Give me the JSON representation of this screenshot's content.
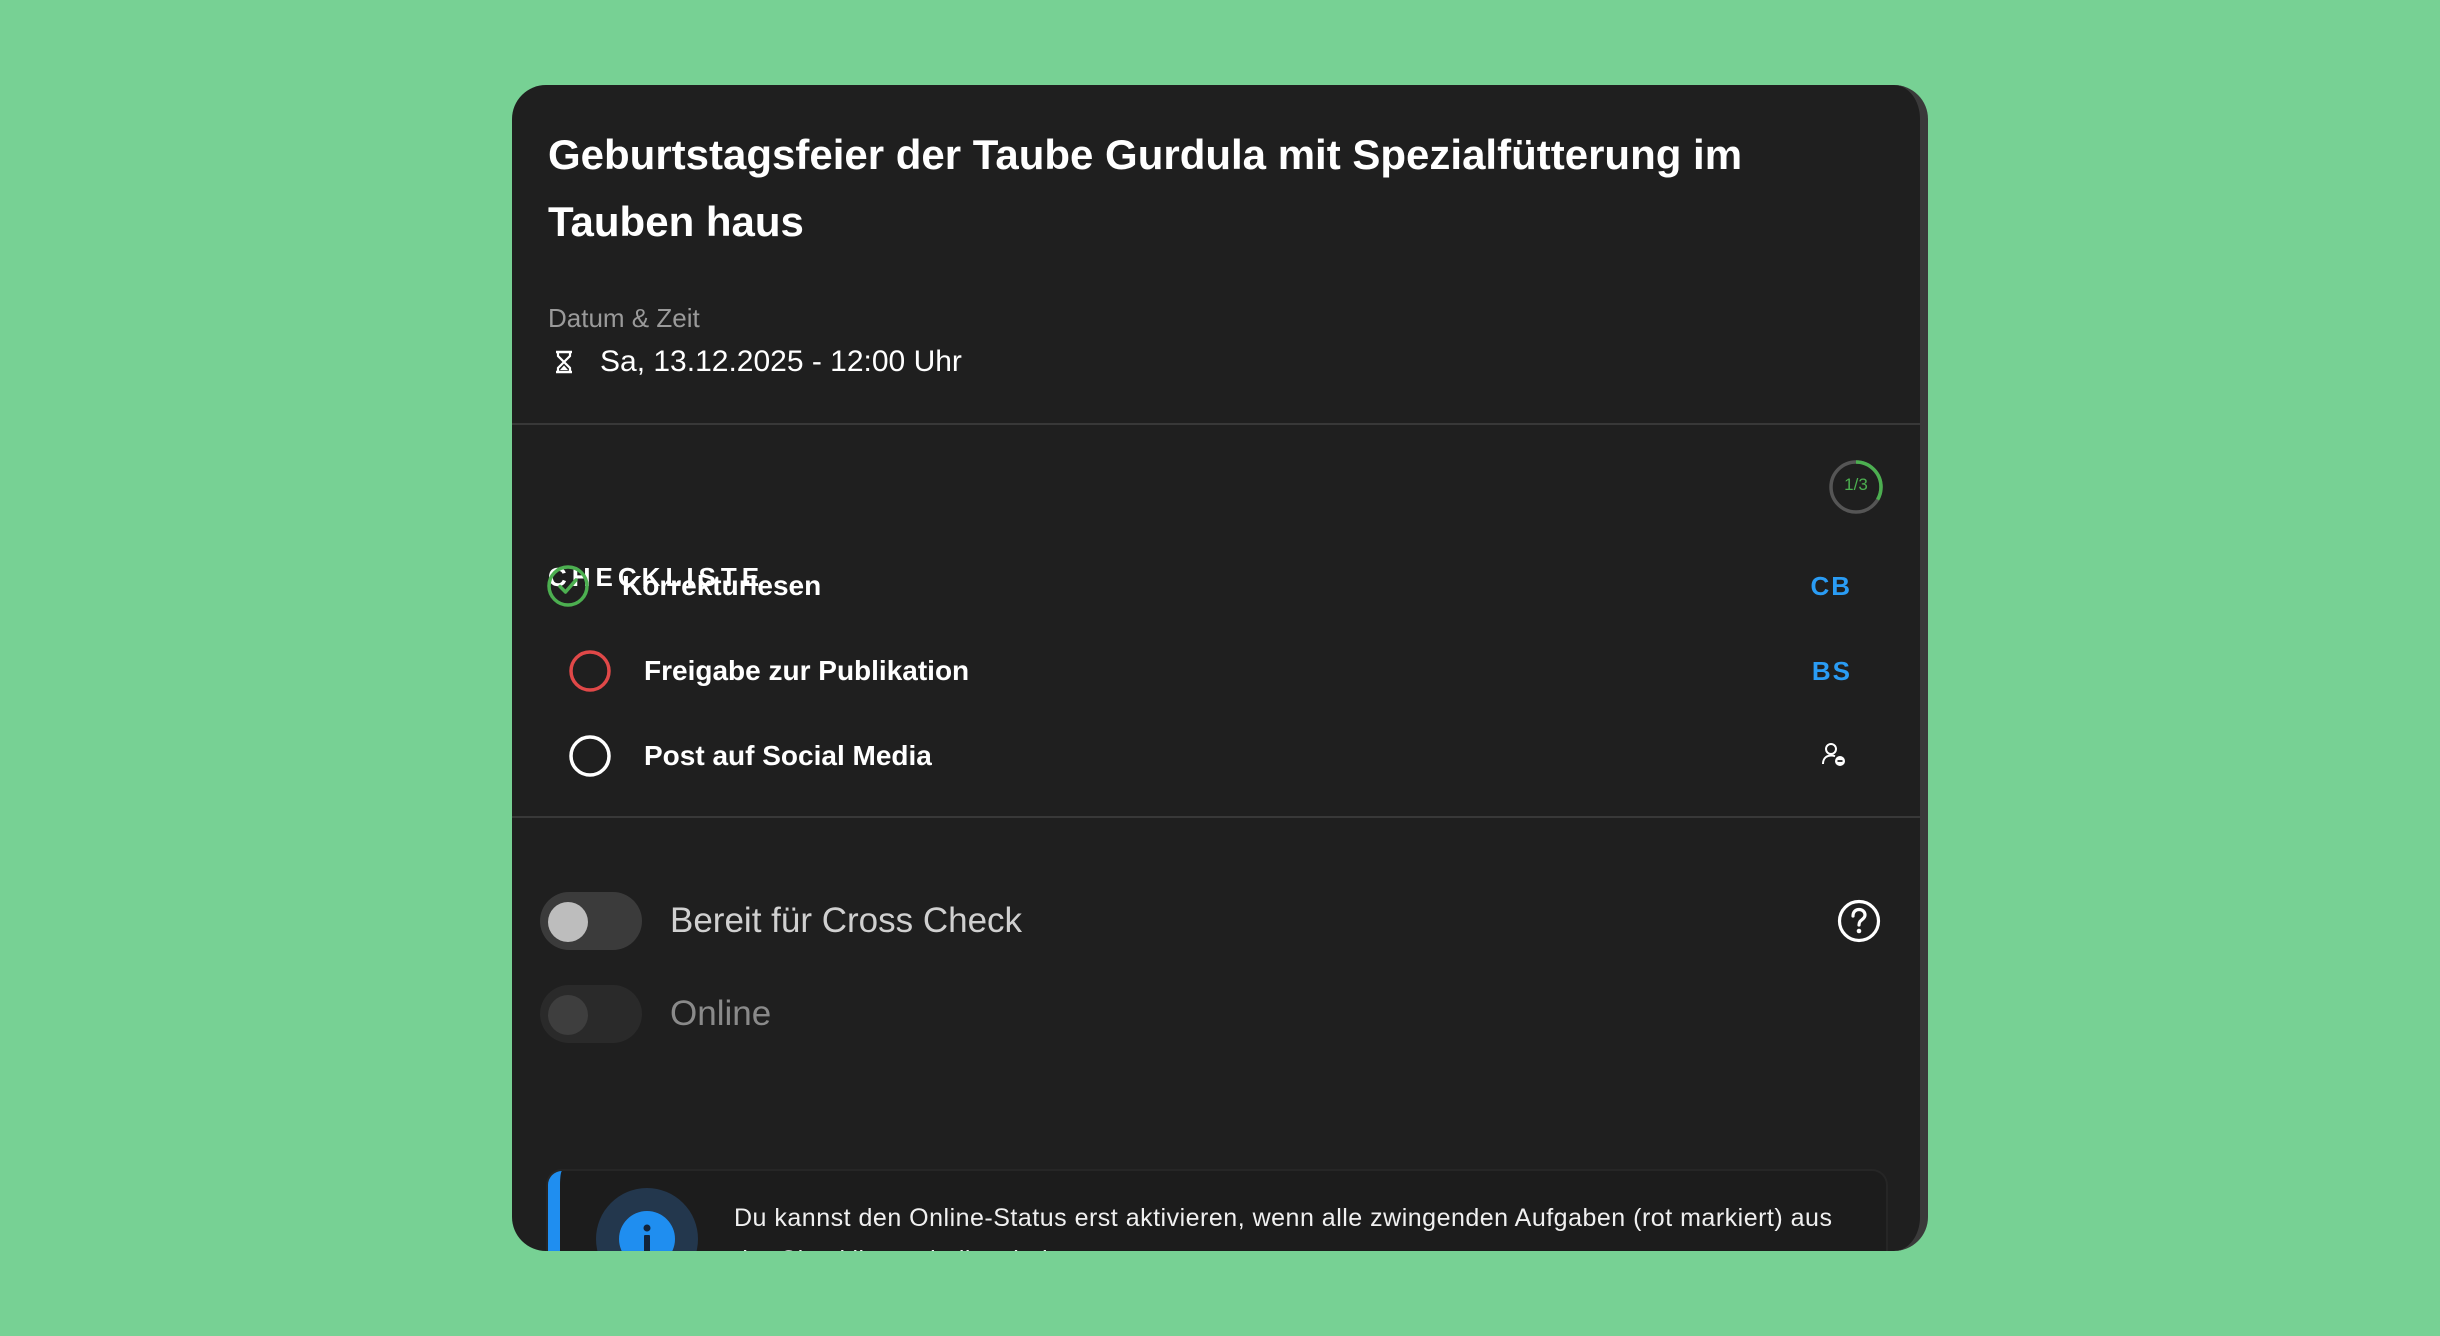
{
  "event": {
    "title": "Geburtstagsfeier der Taube Gurdula mit Spezialfütterung im Tauben haus",
    "datetime_label": "Datum & Zeit",
    "datetime_value": "Sa, 13.12.2025 - 12:00 Uhr",
    "datetime_icon": "hourglass-icon"
  },
  "checklist": {
    "heading": "CHECKLISTE",
    "progress": {
      "done": 1,
      "total": 3,
      "text": "1/3"
    },
    "items": [
      {
        "label": "Korrekturlesen",
        "status": "done",
        "assignee": "CB",
        "icon": "check-circle-icon"
      },
      {
        "label": "Freigabe zur Publikation",
        "status": "required",
        "assignee": "BS",
        "icon": "circle-icon"
      },
      {
        "label": "Post auf Social Media",
        "status": "open",
        "assignee": "",
        "icon": "circle-icon",
        "assignee_icon": "assign-person-icon"
      }
    ]
  },
  "toggles": {
    "cross_check": {
      "label": "Bereit für Cross Check",
      "on": false,
      "enabled": true
    },
    "online": {
      "label": "Online",
      "on": false,
      "enabled": false
    },
    "help_icon": "help-circle-icon"
  },
  "info": {
    "icon": "info-icon",
    "text": "Du kannst den Online-Status erst aktivieren, wenn alle zwingenden Aufgaben (rot markiert) aus der Checkliste erledigt sind."
  },
  "colors": {
    "background": "#77d194",
    "card": "#1f1f1f",
    "success": "#4caf50",
    "required": "#e04848",
    "accent": "#1f8ef0",
    "assignee": "#2a9cf4"
  }
}
